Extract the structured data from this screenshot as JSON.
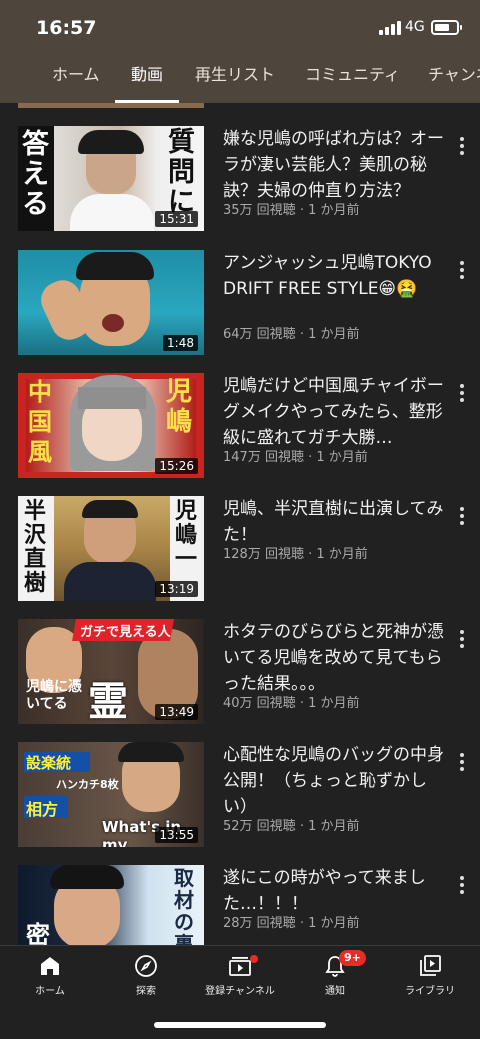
{
  "status": {
    "time": "16:57",
    "network": "4G"
  },
  "tabs": [
    {
      "label": "ホーム"
    },
    {
      "label": "動画"
    },
    {
      "label": "再生リスト"
    },
    {
      "label": "コミュニティ"
    },
    {
      "label": "チャンネ"
    }
  ],
  "active_tab": "動画",
  "videos": [
    {
      "title": "嫌な児嶋の呼ばれ方は？オーラが凄い芸能人？美肌の秘訣？夫婦の仲直り方法？",
      "views": "35万 回視聴",
      "age": "1 か月前",
      "duration": "15:31",
      "thumb_text": [
        "答える",
        "質問に"
      ]
    },
    {
      "title": "アンジャッシュ児嶋TOKYO DRIFT FREE STYLE😁🤮",
      "views": "64万 回視聴",
      "age": "1 か月前",
      "duration": "1:48",
      "thumb_text": []
    },
    {
      "title": "児嶋だけど中国風チャイボーグメイクやってみたら、整形級に盛れてガチ大勝…",
      "views": "147万 回視聴",
      "age": "1 か月前",
      "duration": "15:26",
      "thumb_text": [
        "中国風",
        "児嶋"
      ]
    },
    {
      "title": "児嶋、半沢直樹に出演してみた！",
      "views": "128万 回視聴",
      "age": "1 か月前",
      "duration": "13:19",
      "thumb_text": [
        "半沢直樹",
        "児嶋一"
      ]
    },
    {
      "title": "ホタテのびらびらと死神が憑いてる児嶋を改めて見てもらった結果。。。",
      "views": "40万 回視聴",
      "age": "1 か月前",
      "duration": "13:49",
      "thumb_text": [
        "ガチで見える人",
        "児嶋に憑いてる",
        "霊"
      ]
    },
    {
      "title": "心配性な児嶋のバッグの中身公開！（ちょっと恥ずかしい）",
      "views": "52万 回視聴",
      "age": "1 か月前",
      "duration": "13:55",
      "thumb_text": [
        "設楽統",
        "ハンカチ8枚",
        "相方",
        "What's in my"
      ]
    },
    {
      "title": "遂にこの時がやって来ました…！！！",
      "views": "28万 回視聴",
      "age": "1 か月前",
      "duration": "",
      "thumb_text": [
        "取材の裏",
        "密"
      ]
    }
  ],
  "nav": [
    {
      "label": "ホーム",
      "icon": "home-icon"
    },
    {
      "label": "探索",
      "icon": "compass-icon"
    },
    {
      "label": "登録チャンネル",
      "icon": "subscriptions-icon"
    },
    {
      "label": "通知",
      "icon": "bell-icon",
      "badge": "9+"
    },
    {
      "label": "ライブラリ",
      "icon": "library-icon"
    }
  ],
  "colors": {
    "header": "#4e453c",
    "background": "#212121",
    "badge": "#e52d27"
  }
}
